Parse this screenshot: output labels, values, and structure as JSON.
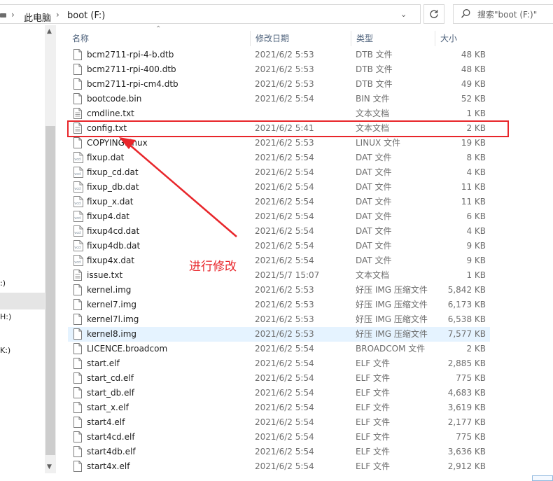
{
  "address": {
    "breadcrumbs": [
      "此电脑",
      "boot (F:)"
    ]
  },
  "search": {
    "placeholder": "搜索\"boot (F:)\""
  },
  "navpane": {
    "items": [
      ":)",
      "H:)",
      "K:)"
    ]
  },
  "columns": {
    "name": "名称",
    "date": "修改日期",
    "type": "类型",
    "size": "大小"
  },
  "files": [
    {
      "name": "bcm2711-rpi-4-b.dtb",
      "date": "2021/6/2 5:53",
      "type": "DTB 文件",
      "size": "48 KB",
      "icon": "document-icon"
    },
    {
      "name": "bcm2711-rpi-400.dtb",
      "date": "2021/6/2 5:53",
      "type": "DTB 文件",
      "size": "48 KB",
      "icon": "document-icon"
    },
    {
      "name": "bcm2711-rpi-cm4.dtb",
      "date": "2021/6/2 5:53",
      "type": "DTB 文件",
      "size": "49 KB",
      "icon": "document-icon"
    },
    {
      "name": "bootcode.bin",
      "date": "2021/6/2 5:54",
      "type": "BIN 文件",
      "size": "52 KB",
      "icon": "document-icon"
    },
    {
      "name": "cmdline.txt",
      "date": "",
      "type": "文本文档",
      "size": "1 KB",
      "icon": "text-document-icon"
    },
    {
      "name": "config.txt",
      "date": "2021/6/2 5:41",
      "type": "文本文档",
      "size": "2 KB",
      "icon": "text-document-icon"
    },
    {
      "name": "COPYING.linux",
      "date": "2021/6/2 5:53",
      "type": "LINUX 文件",
      "size": "19 KB",
      "icon": "document-icon"
    },
    {
      "name": "fixup.dat",
      "date": "2021/6/2 5:54",
      "type": "DAT 文件",
      "size": "8 KB",
      "icon": "vcd-file-icon"
    },
    {
      "name": "fixup_cd.dat",
      "date": "2021/6/2 5:54",
      "type": "DAT 文件",
      "size": "4 KB",
      "icon": "vcd-file-icon"
    },
    {
      "name": "fixup_db.dat",
      "date": "2021/6/2 5:54",
      "type": "DAT 文件",
      "size": "11 KB",
      "icon": "vcd-file-icon"
    },
    {
      "name": "fixup_x.dat",
      "date": "2021/6/2 5:54",
      "type": "DAT 文件",
      "size": "11 KB",
      "icon": "vcd-file-icon"
    },
    {
      "name": "fixup4.dat",
      "date": "2021/6/2 5:54",
      "type": "DAT 文件",
      "size": "6 KB",
      "icon": "vcd-file-icon"
    },
    {
      "name": "fixup4cd.dat",
      "date": "2021/6/2 5:54",
      "type": "DAT 文件",
      "size": "4 KB",
      "icon": "vcd-file-icon"
    },
    {
      "name": "fixup4db.dat",
      "date": "2021/6/2 5:54",
      "type": "DAT 文件",
      "size": "9 KB",
      "icon": "vcd-file-icon"
    },
    {
      "name": "fixup4x.dat",
      "date": "2021/6/2 5:54",
      "type": "DAT 文件",
      "size": "9 KB",
      "icon": "vcd-file-icon"
    },
    {
      "name": "issue.txt",
      "date": "2021/5/7 15:07",
      "type": "文本文档",
      "size": "1 KB",
      "icon": "text-document-icon"
    },
    {
      "name": "kernel.img",
      "date": "2021/6/2 5:53",
      "type": "好压 IMG 压缩文件",
      "size": "5,842 KB",
      "icon": "document-icon"
    },
    {
      "name": "kernel7.img",
      "date": "2021/6/2 5:53",
      "type": "好压 IMG 压缩文件",
      "size": "6,173 KB",
      "icon": "document-icon"
    },
    {
      "name": "kernel7l.img",
      "date": "2021/6/2 5:53",
      "type": "好压 IMG 压缩文件",
      "size": "6,538 KB",
      "icon": "document-icon"
    },
    {
      "name": "kernel8.img",
      "date": "2021/6/2 5:53",
      "type": "好压 IMG 压缩文件",
      "size": "7,577 KB",
      "icon": "document-icon",
      "highlighted": true
    },
    {
      "name": "LICENCE.broadcom",
      "date": "2021/6/2 5:54",
      "type": "BROADCOM 文件",
      "size": "2 KB",
      "icon": "document-icon"
    },
    {
      "name": "start.elf",
      "date": "2021/6/2 5:54",
      "type": "ELF 文件",
      "size": "2,885 KB",
      "icon": "document-icon"
    },
    {
      "name": "start_cd.elf",
      "date": "2021/6/2 5:54",
      "type": "ELF 文件",
      "size": "775 KB",
      "icon": "document-icon"
    },
    {
      "name": "start_db.elf",
      "date": "2021/6/2 5:54",
      "type": "ELF 文件",
      "size": "4,683 KB",
      "icon": "document-icon"
    },
    {
      "name": "start_x.elf",
      "date": "2021/6/2 5:54",
      "type": "ELF 文件",
      "size": "3,619 KB",
      "icon": "document-icon"
    },
    {
      "name": "start4.elf",
      "date": "2021/6/2 5:54",
      "type": "ELF 文件",
      "size": "2,177 KB",
      "icon": "document-icon"
    },
    {
      "name": "start4cd.elf",
      "date": "2021/6/2 5:54",
      "type": "ELF 文件",
      "size": "775 KB",
      "icon": "document-icon"
    },
    {
      "name": "start4db.elf",
      "date": "2021/6/2 5:54",
      "type": "ELF 文件",
      "size": "3,636 KB",
      "icon": "document-icon"
    },
    {
      "name": "start4x.elf",
      "date": "2021/6/2 5:54",
      "type": "ELF 文件",
      "size": "2,912 KB",
      "icon": "document-icon"
    }
  ],
  "annotation": {
    "label": "进行修改",
    "color": "#e8262b",
    "target_file": "config.txt"
  },
  "colors": {
    "selection": "#e5f3ff",
    "header_text": "#4c607a",
    "secondary_text": "#6d6d6d"
  }
}
